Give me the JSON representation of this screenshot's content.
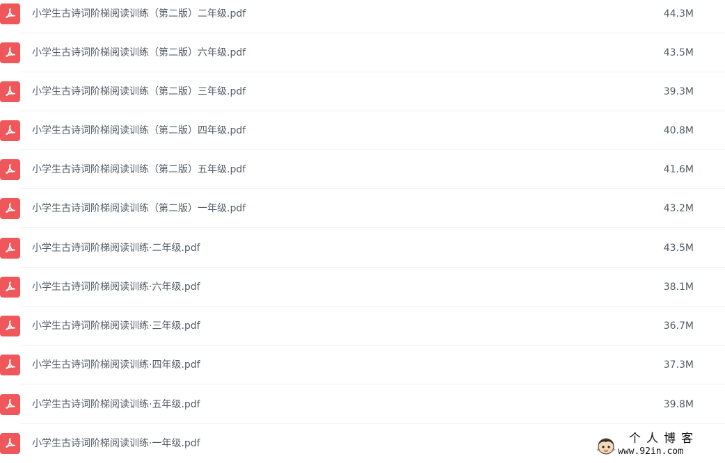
{
  "colors": {
    "pdf_icon_bg": "#f0575a",
    "text": "#545b66",
    "divider": "#f0f0f0"
  },
  "files": [
    {
      "name": "小学生古诗词阶梯阅读训练（第二版）二年级.pdf",
      "size": "44.3M",
      "icon": "pdf-icon"
    },
    {
      "name": "小学生古诗词阶梯阅读训练（第二版）六年级.pdf",
      "size": "43.5M",
      "icon": "pdf-icon"
    },
    {
      "name": "小学生古诗词阶梯阅读训练（第二版）三年级.pdf",
      "size": "39.3M",
      "icon": "pdf-icon"
    },
    {
      "name": "小学生古诗词阶梯阅读训练（第二版）四年级.pdf",
      "size": "40.8M",
      "icon": "pdf-icon"
    },
    {
      "name": "小学生古诗词阶梯阅读训练（第二版）五年级.pdf",
      "size": "41.6M",
      "icon": "pdf-icon"
    },
    {
      "name": "小学生古诗词阶梯阅读训练（第二版）一年级.pdf",
      "size": "43.2M",
      "icon": "pdf-icon"
    },
    {
      "name": "小学生古诗词阶梯阅读训练·二年级.pdf",
      "size": "43.5M",
      "icon": "pdf-icon"
    },
    {
      "name": "小学生古诗词阶梯阅读训练·六年级.pdf",
      "size": "38.1M",
      "icon": "pdf-icon"
    },
    {
      "name": "小学生古诗词阶梯阅读训练·三年级.pdf",
      "size": "36.7M",
      "icon": "pdf-icon"
    },
    {
      "name": "小学生古诗词阶梯阅读训练·四年级.pdf",
      "size": "37.3M",
      "icon": "pdf-icon"
    },
    {
      "name": "小学生古诗词阶梯阅读训练·五年级.pdf",
      "size": "39.8M",
      "icon": "pdf-icon"
    },
    {
      "name": "小学生古诗词阶梯阅读训练·一年级.pdf",
      "size": "",
      "icon": "pdf-icon"
    }
  ],
  "watermark": {
    "title": "个人博客",
    "url": "www.92in.com"
  }
}
